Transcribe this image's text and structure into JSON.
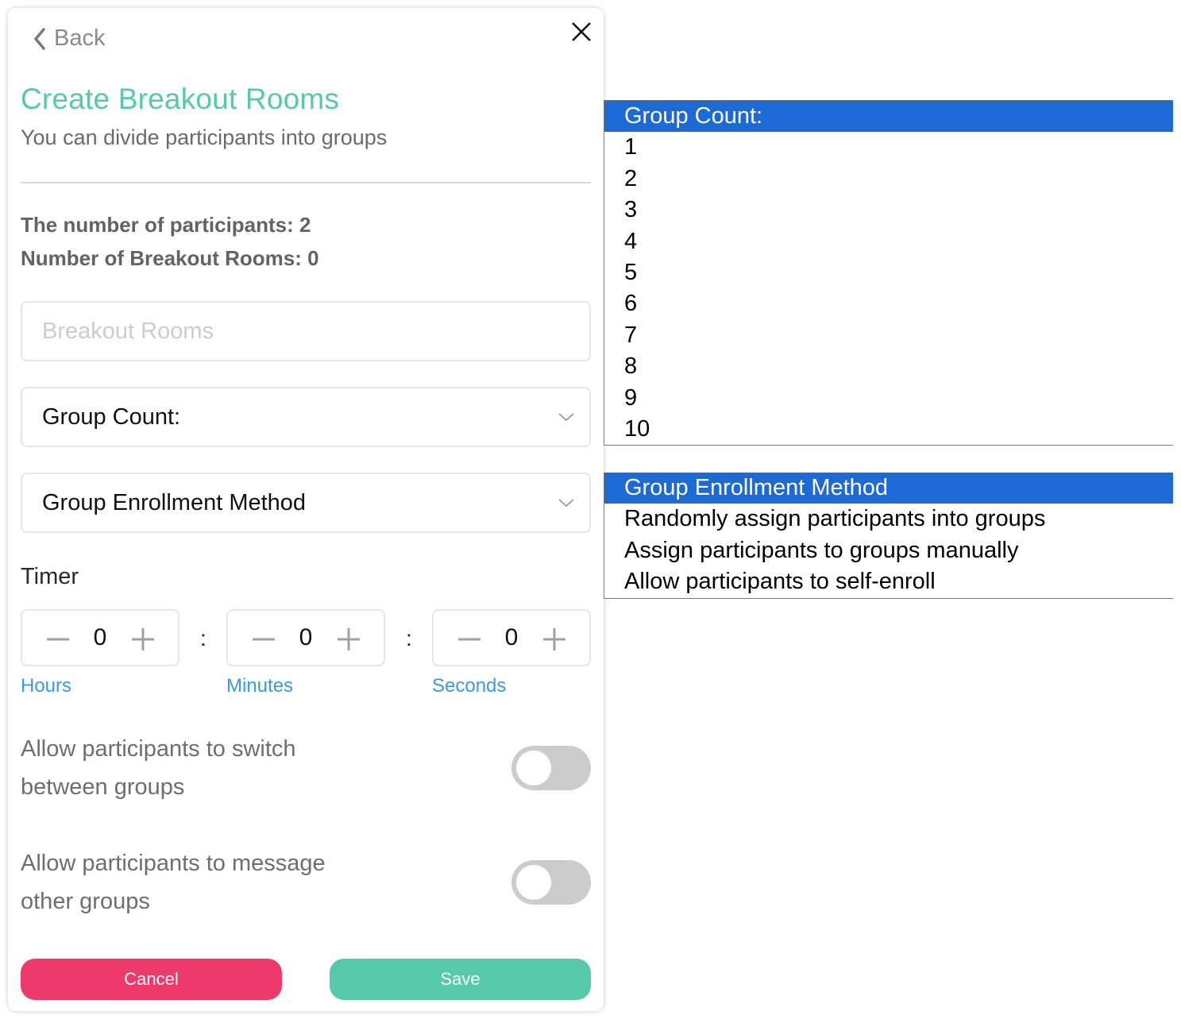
{
  "header": {
    "back_label": "Back",
    "back_icon": "chevron-left-icon",
    "close_icon": "close-icon"
  },
  "title": "Create Breakout Rooms",
  "subtitle": "You can divide participants into groups",
  "stats": {
    "participants": "The number of participants: 2",
    "breakout_rooms": "Number of Breakout Rooms: 0"
  },
  "breakout_input": {
    "value": "",
    "placeholder": "Breakout Rooms"
  },
  "group_count_select": {
    "selected": "Group Count:",
    "icon": "chevron-down-icon"
  },
  "enrollment_select": {
    "selected": "Group Enrollment Method",
    "icon": "chevron-down-icon"
  },
  "timer": {
    "label": "Timer",
    "separator": ":",
    "fields": [
      {
        "unit": "Hours",
        "value": "0"
      },
      {
        "unit": "Minutes",
        "value": "0"
      },
      {
        "unit": "Seconds",
        "value": "0"
      }
    ]
  },
  "toggles": [
    {
      "line1": "Allow participants to switch",
      "line2": "between groups",
      "on": false
    },
    {
      "line1": "Allow participants to message",
      "line2": "other groups",
      "on": false
    }
  ],
  "buttons": {
    "cancel": "Cancel",
    "save": "Save"
  },
  "colors": {
    "accent": "#55c9a8",
    "danger": "#ee3a6a",
    "link": "#3a9ae0",
    "highlight": "#1d69d6"
  },
  "group_count_options": [
    "Group Count:",
    "1",
    "2",
    "3",
    "4",
    "5",
    "6",
    "7",
    "8",
    "9",
    "10"
  ],
  "enrollment_options": [
    "Group Enrollment Method",
    "Randomly assign participants into groups",
    "Assign participants to groups manually",
    "Allow participants to self-enroll"
  ]
}
